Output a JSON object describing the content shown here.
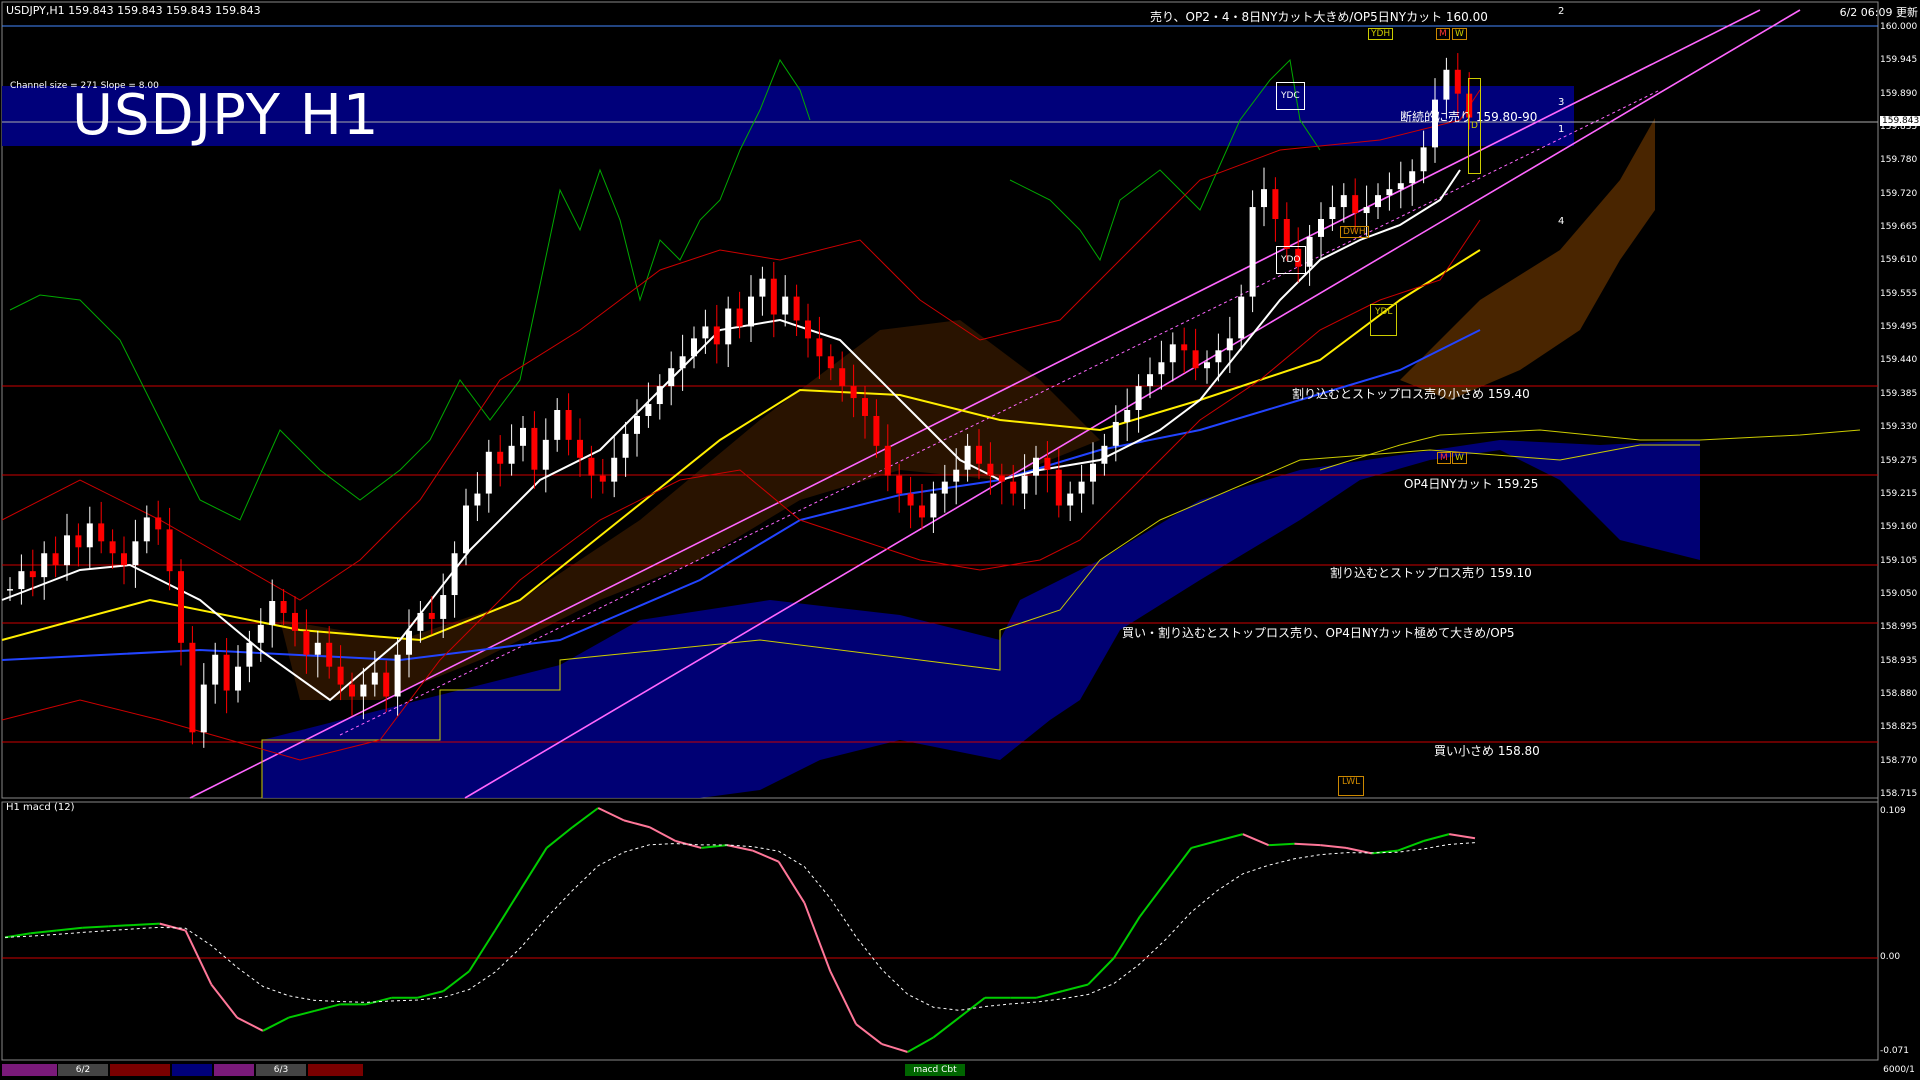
{
  "header": {
    "symbol_info": "USDJPY,H1  159.843 159.843 159.843 159.843",
    "clock": "6/2 06:09 更新",
    "channel_info": "Channel size = 271 Slope = 8.00",
    "big_title": "USDJPY H1",
    "macd_label": "H1  macd (12)"
  },
  "colors": {
    "background": "#000000",
    "bull_candle": "#ffffff",
    "bear_candle": "#ff0000",
    "channel": "#ff66ff",
    "level_line": "#cc0000",
    "cloud_fill": "#000088",
    "title_band": "#00007a",
    "macd_up": "#00cc00",
    "macd_down": "#ff7799"
  },
  "price_axis": [
    "160.000",
    "159.945",
    "159.890",
    "159.835",
    "159.780",
    "159.720",
    "159.665",
    "159.610",
    "159.555",
    "159.495",
    "159.440",
    "159.385",
    "159.330",
    "159.275",
    "159.215",
    "159.160",
    "159.105",
    "159.050",
    "158.995",
    "158.935",
    "158.880",
    "158.825",
    "158.770",
    "158.715"
  ],
  "current_price": "159.843",
  "macd_axis": [
    "0.109",
    "0.00",
    "-0.071"
  ],
  "annotations": {
    "top": "売り、OP2・4・8日NYカット大きめ/OP5日NYカット 160.00",
    "sell_steadily": "断続的に売り 159.80-90",
    "l1": "割り込むとストップロス売り小さめ 159.40",
    "l2": "OP4日NYカット 159.25",
    "l3": "割り込むとストップロス売り 159.10",
    "l4": "買い・割り込むとストップロス売り、OP4日NYカット極めて大きめ/OP5",
    "l5": "買い小さめ 158.80"
  },
  "channel_numbers": [
    "2",
    "3",
    "1",
    "4"
  ],
  "boxes": {
    "ydh": "YDH",
    "ydc": "YDC",
    "ydo": "YDO",
    "ydl": "YDL",
    "dwh": "DWH",
    "lwl": "LWL",
    "m": "M",
    "w": "W",
    "d": "D"
  },
  "bottom_bar": {
    "dates": [
      "6/2",
      "6/3"
    ],
    "macd_tag": "macd Cbt",
    "counter": "6000/1"
  },
  "chart_data": {
    "type": "candlestick",
    "title": "USDJPY H1",
    "ylim": [
      158.715,
      160.0
    ],
    "levels": [
      159.4,
      159.25,
      159.1,
      158.995,
      158.8,
      160.0
    ],
    "close": [
      159.06,
      159.09,
      159.08,
      159.12,
      159.1,
      159.15,
      159.13,
      159.17,
      159.14,
      159.12,
      159.1,
      159.14,
      159.18,
      159.16,
      159.09,
      158.97,
      158.82,
      158.9,
      158.95,
      158.89,
      158.93,
      158.97,
      159.0,
      159.04,
      159.02,
      158.99,
      158.95,
      158.97,
      158.93,
      158.9,
      158.88,
      158.9,
      158.92,
      158.88,
      158.95,
      158.99,
      159.02,
      159.01,
      159.05,
      159.12,
      159.2,
      159.22,
      159.29,
      159.27,
      159.3,
      159.33,
      159.26,
      159.31,
      159.36,
      159.31,
      159.28,
      159.25,
      159.24,
      159.28,
      159.32,
      159.35,
      159.37,
      159.4,
      159.43,
      159.45,
      159.48,
      159.5,
      159.47,
      159.53,
      159.5,
      159.55,
      159.58,
      159.52,
      159.55,
      159.51,
      159.48,
      159.45,
      159.43,
      159.4,
      159.38,
      159.35,
      159.3,
      159.25,
      159.22,
      159.2,
      159.18,
      159.22,
      159.24,
      159.26,
      159.3,
      159.27,
      159.25,
      159.24,
      159.22,
      159.25,
      159.28,
      159.26,
      159.2,
      159.22,
      159.24,
      159.27,
      159.3,
      159.34,
      159.36,
      159.4,
      159.42,
      159.44,
      159.47,
      159.46,
      159.43,
      159.44,
      159.46,
      159.48,
      159.55,
      159.7,
      159.73,
      159.68,
      159.63,
      159.6,
      159.65,
      159.68,
      159.7,
      159.72,
      159.69,
      159.7,
      159.72,
      159.73,
      159.74,
      159.76,
      159.8,
      159.88,
      159.93,
      159.89,
      159.85
    ],
    "macd": [
      0.015,
      0.018,
      0.02,
      0.022,
      0.023,
      0.024,
      0.025,
      0.02,
      -0.02,
      -0.045,
      -0.055,
      -0.045,
      -0.04,
      -0.035,
      -0.035,
      -0.03,
      -0.03,
      -0.025,
      -0.01,
      0.02,
      0.05,
      0.08,
      0.095,
      0.109,
      0.1,
      0.095,
      0.085,
      0.08,
      0.082,
      0.078,
      0.07,
      0.04,
      -0.01,
      -0.05,
      -0.065,
      -0.071,
      -0.06,
      -0.045,
      -0.03,
      -0.03,
      -0.03,
      -0.025,
      -0.02,
      0.0,
      0.03,
      0.055,
      0.08,
      0.085,
      0.09,
      0.082,
      0.083,
      0.082,
      0.08,
      0.076,
      0.078,
      0.085,
      0.09,
      0.087
    ]
  }
}
